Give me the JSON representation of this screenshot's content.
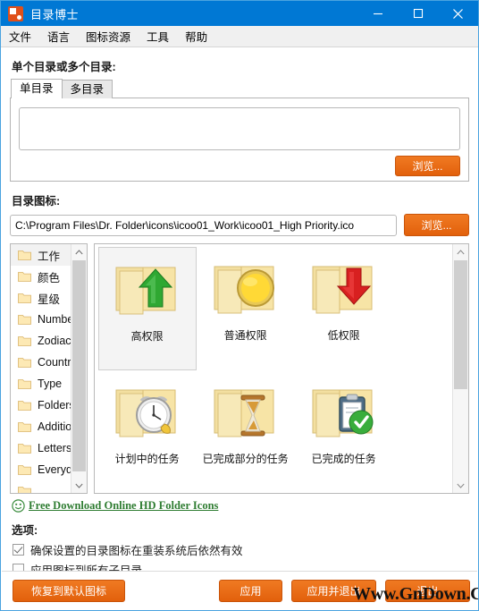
{
  "window": {
    "title": "目录博士",
    "app_icon": "folder-doctor-icon",
    "minimize": "minimize-icon",
    "maximize": "maximize-icon",
    "close": "close-icon",
    "titlebar_color": "#0078d4",
    "accent_color": "#e2600c"
  },
  "menu": {
    "items": [
      {
        "label": "文件"
      },
      {
        "label": "语言"
      },
      {
        "label": "图标资源"
      },
      {
        "label": "工具"
      },
      {
        "label": "帮助"
      }
    ]
  },
  "directory_section": {
    "label": "单个目录或多个目录:",
    "tabs": [
      {
        "label": "单目录",
        "active": true
      },
      {
        "label": "多目录",
        "active": false
      }
    ],
    "input_value": "",
    "input_placeholder": "",
    "browse_label": "浏览..."
  },
  "icon_section": {
    "label": "目录图标:",
    "path_value": "C:\\Program Files\\Dr. Folder\\icons\\icoo01_Work\\icoo01_High Priority.ico",
    "path_placeholder": "",
    "browse_label": "浏览..."
  },
  "categories": {
    "items": [
      {
        "label": "工作",
        "selected": true
      },
      {
        "label": "颜色",
        "selected": false
      },
      {
        "label": "星级",
        "selected": false
      },
      {
        "label": "Numbers",
        "selected": false
      },
      {
        "label": "Zodiac",
        "selected": false
      },
      {
        "label": "Country Flags",
        "selected": false
      },
      {
        "label": "Type",
        "selected": false
      },
      {
        "label": "Folders",
        "selected": false
      },
      {
        "label": "Additional",
        "selected": false
      },
      {
        "label": "Letters",
        "selected": false
      },
      {
        "label": "Everyday",
        "selected": false
      }
    ]
  },
  "icons": {
    "items": [
      {
        "label": "高权限",
        "art": "folder-green-up-arrow",
        "selected": true
      },
      {
        "label": "普通权限",
        "art": "folder-yellow-circle",
        "selected": false
      },
      {
        "label": "低权限",
        "art": "folder-red-down-arrow",
        "selected": false
      },
      {
        "label": "计划中的任务",
        "art": "folder-alarm-clock",
        "selected": false
      },
      {
        "label": "已完成部分的任务",
        "art": "folder-hourglass",
        "selected": false
      },
      {
        "label": "已完成的任务",
        "art": "folder-clipboard-check",
        "selected": false
      }
    ]
  },
  "download_link": {
    "icon": "smiley-icon",
    "label": "Free Download Online HD Folder Icons",
    "color": "#2f7d32"
  },
  "options": {
    "label": "选项:",
    "items": [
      {
        "label": "确保设置的目录图标在重装系统后依然有效",
        "checked": true
      },
      {
        "label": "应用图标到所有子目录",
        "checked": false
      }
    ]
  },
  "footer": {
    "restore_label": "恢复到默认图标",
    "apply_label": "应用",
    "apply_exit_label": "应用并退出",
    "exit_label": "退出"
  },
  "watermark": {
    "text": "Www.GnDown.Com"
  }
}
